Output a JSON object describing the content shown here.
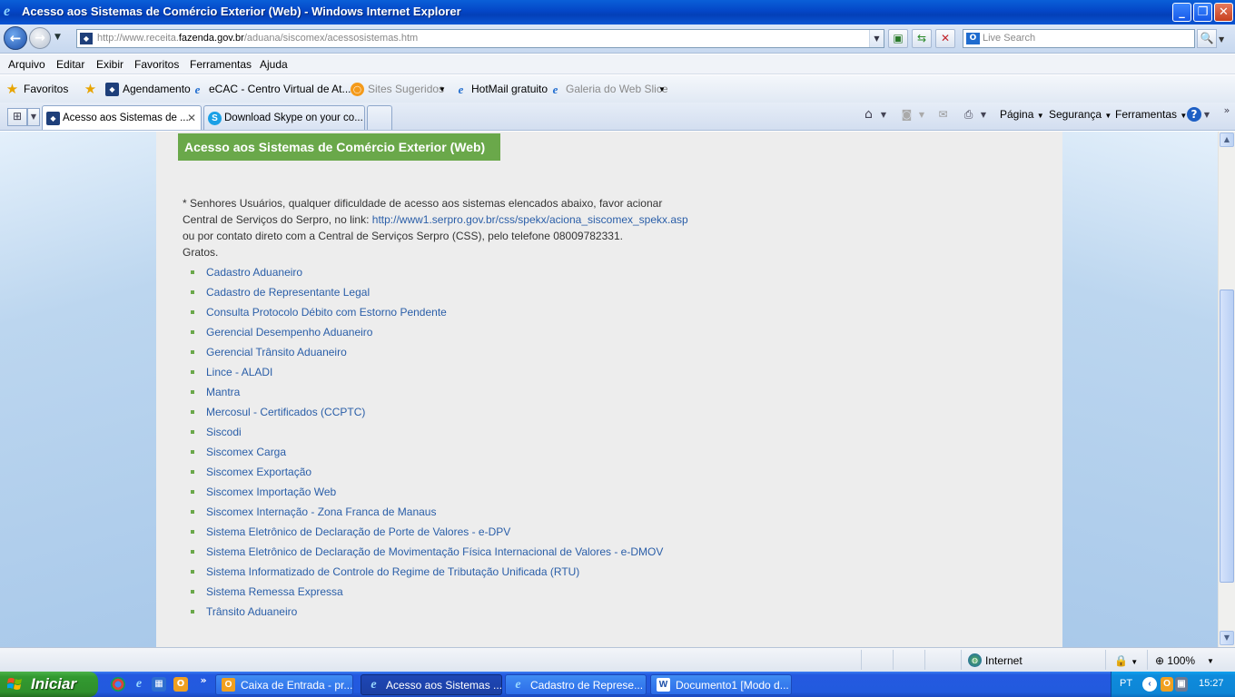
{
  "window": {
    "title": "Acesso aos Sistemas de Comércio Exterior (Web) - Windows Internet Explorer",
    "controls": [
      "minimize",
      "restore",
      "close"
    ]
  },
  "navigation": {
    "url_prefix": "http://www.receita.",
    "url_domain": "fazenda.gov.br",
    "url_path": "/aduana/siscomex/acessosistemas.htm",
    "search_placeholder": "Live Search"
  },
  "menu": [
    "Arquivo",
    "Editar",
    "Exibir",
    "Favoritos",
    "Ferramentas",
    "Ajuda"
  ],
  "favorites_bar": {
    "favorites_label": "Favoritos",
    "items": [
      {
        "label": "Agendamento",
        "icon": "receita-icon"
      },
      {
        "label": "eCAC - Centro Virtual de At...",
        "icon": "ie-page-icon"
      },
      {
        "label": "Sites Sugeridos",
        "icon": "suggested-sites-icon",
        "dropdown": true,
        "disabled": true
      },
      {
        "label": "HotMail gratuito",
        "icon": "ie-page-icon"
      },
      {
        "label": "Galeria do Web Slice",
        "icon": "ie-page-icon",
        "dropdown": true,
        "disabled": true
      }
    ]
  },
  "tabs": [
    {
      "label": "Acesso aos Sistemas de ...",
      "active": true,
      "icon": "receita-icon"
    },
    {
      "label": "Download Skype on your co...",
      "active": false,
      "icon": "skype-icon"
    }
  ],
  "command_bar": {
    "page": "Página",
    "security": "Segurança",
    "tools": "Ferramentas"
  },
  "page": {
    "heading": "Acesso aos Sistemas de Comércio Exterior (Web)",
    "notice_line1": "* Senhores Usuários, qualquer dificuldade de acesso aos sistemas elencados abaixo, favor acionar",
    "notice_line2_prefix": "Central de Serviços do Serpro, no link: ",
    "notice_link": "http://www1.serpro.gov.br/css/spekx/aciona_siscomex_spekx.asp",
    "notice_line3": "ou por contato direto com a Central de Serviços Serpro (CSS), pelo telefone 08009782331.",
    "notice_line4": "Gratos.",
    "systems": [
      "Cadastro Aduaneiro",
      "Cadastro de Representante Legal",
      "Consulta Protocolo Débito com Estorno Pendente",
      "Gerencial Desempenho Aduaneiro",
      "Gerencial Trânsito Aduaneiro",
      "Lince - ALADI",
      "Mantra",
      "Mercosul - Certificados (CCPTC)",
      "Siscodi",
      "Siscomex Carga",
      "Siscomex Exportação",
      "Siscomex Importação Web",
      "Siscomex Internação - Zona Franca de Manaus",
      "Sistema Eletrônico de Declaração de Porte de Valores - e-DPV",
      "Sistema Eletrônico de Declaração de Movimentação Física Internacional de Valores - e-DMOV",
      "Sistema Informatizado de Controle do Regime de Tributação Unificada (RTU)",
      "Sistema Remessa Expressa",
      "Trânsito Aduaneiro"
    ]
  },
  "status_bar": {
    "zone": "Internet",
    "zoom": "100%"
  },
  "taskbar": {
    "start_label": "Iniciar",
    "tasks": [
      {
        "label": "Caixa de Entrada - pr...",
        "icon": "outlook-icon",
        "active": false
      },
      {
        "label": "Acesso aos Sistemas ...",
        "icon": "ie-icon",
        "active": true
      },
      {
        "label": "Cadastro de Represe...",
        "icon": "ie-icon",
        "active": false
      },
      {
        "label": "Documento1 [Modo d...",
        "icon": "word-icon",
        "active": false
      }
    ],
    "tray_lang": "PT",
    "clock": "15:27"
  },
  "colors": {
    "heading_bg": "#6aa84a",
    "link": "#2a5ea8",
    "panel_bg": "#ededed",
    "page_bg": "#c5dcf2"
  }
}
